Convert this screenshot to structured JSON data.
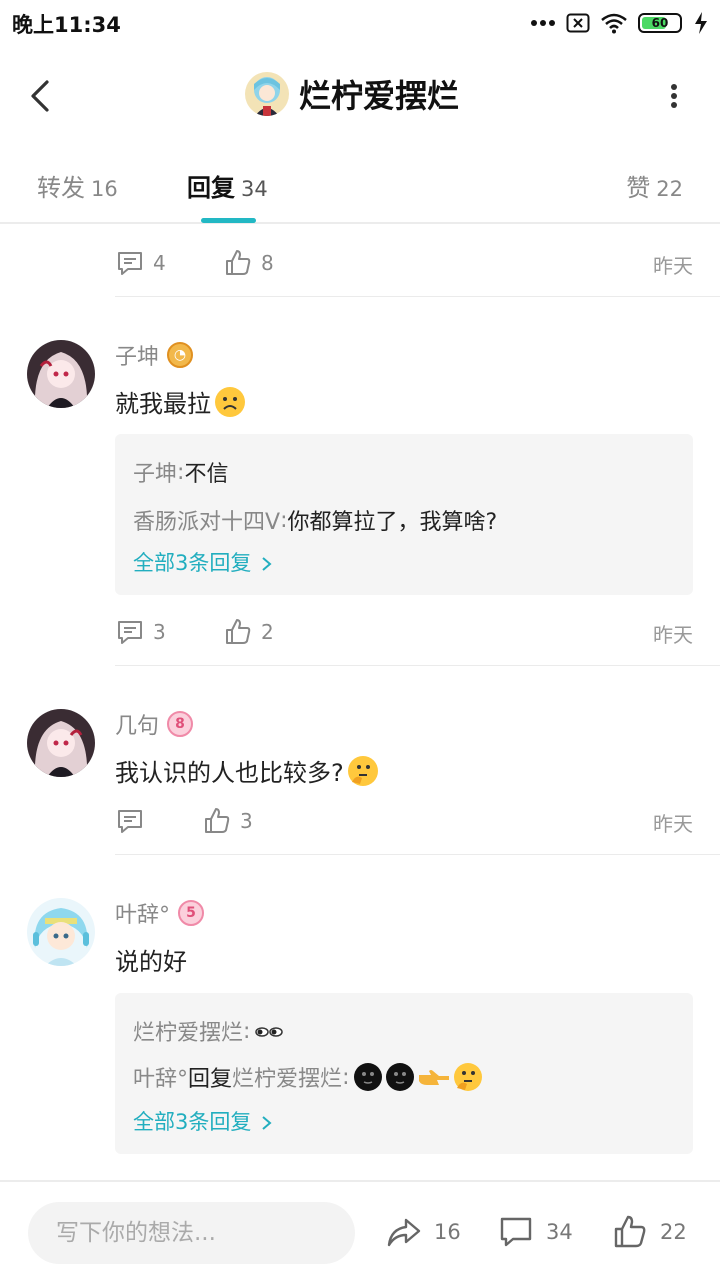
{
  "status_bar": {
    "time": "晚上11:34",
    "battery": "60"
  },
  "header": {
    "title": "烂柠爱摆烂"
  },
  "tabs": [
    {
      "label": "转发",
      "count": "16"
    },
    {
      "label": "回复",
      "count": "34"
    },
    {
      "label": "赞",
      "count": "22"
    }
  ],
  "prev_item": {
    "comments": "4",
    "likes": "8",
    "time": "昨天"
  },
  "comments": [
    {
      "user": "子坤",
      "text": "就我最拉",
      "replies": [
        {
          "user": "子坤",
          "sep": " : ",
          "text": "不信"
        },
        {
          "user": "香肠派对十四V",
          "sep": " : ",
          "text": "你都算拉了，我算啥?"
        }
      ],
      "more_replies": "全部3条回复",
      "comments": "3",
      "likes": "2",
      "time": "昨天"
    },
    {
      "user": "几句",
      "text": "我认识的人也比较多?",
      "comments": "",
      "likes": "3",
      "time": "昨天"
    },
    {
      "user": "叶⁧辞⁩⁧⁩⁧⁩°",
      "text": "说的好",
      "replies": [
        {
          "user": "烂柠爱摆烂",
          "sep": " : ",
          "text": ""
        },
        {
          "user": "叶⁧辞⁩⁧⁩⁧⁩°",
          "mid": " 回复 ",
          "target": "烂柠爱摆烂",
          "sep": " : ",
          "text": ""
        }
      ],
      "more_replies": "全部3条回复"
    }
  ],
  "bottom_bar": {
    "placeholder": "写下你的想法...",
    "reposts": "16",
    "replies": "34",
    "likes": "22"
  },
  "colors": {
    "accent": "#22b8c4",
    "link": "#22aebf"
  }
}
